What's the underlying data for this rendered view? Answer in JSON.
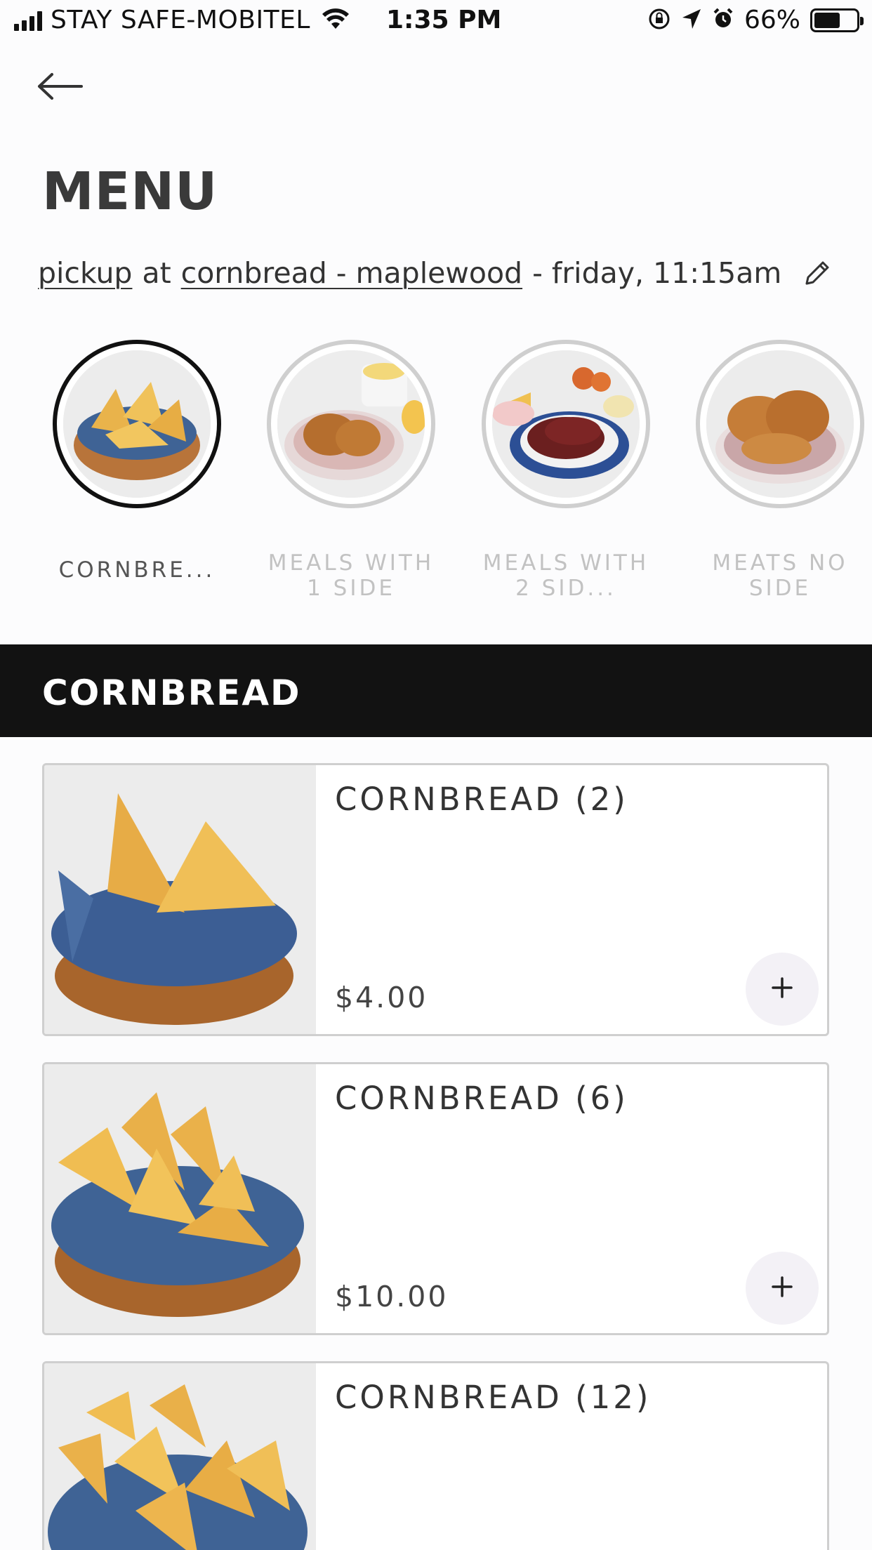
{
  "status_bar": {
    "carrier": "STAY SAFE-MOBITEL",
    "time": "1:35 PM",
    "battery": "66%"
  },
  "header": {
    "title": "MENU"
  },
  "pickup": {
    "mode": "pickup",
    "at": "at",
    "location": "cornbread - maplewood",
    "schedule": "- friday, 11:15am"
  },
  "categories": [
    {
      "label": "CORNBRE...",
      "active": true
    },
    {
      "label": "MEALS WITH 1 SIDE",
      "active": false
    },
    {
      "label": "MEALS WITH 2 SID...",
      "active": false
    },
    {
      "label": "MEATS NO SIDE",
      "active": false
    }
  ],
  "section": {
    "title": "CORNBREAD"
  },
  "products": [
    {
      "name": "CORNBREAD (2)",
      "price": "$4.00"
    },
    {
      "name": "CORNBREAD (6)",
      "price": "$10.00"
    },
    {
      "name": "CORNBREAD (12)",
      "price": ""
    }
  ],
  "icons": {
    "back": "arrow-left-icon",
    "edit": "pencil-icon",
    "add": "plus-icon"
  }
}
